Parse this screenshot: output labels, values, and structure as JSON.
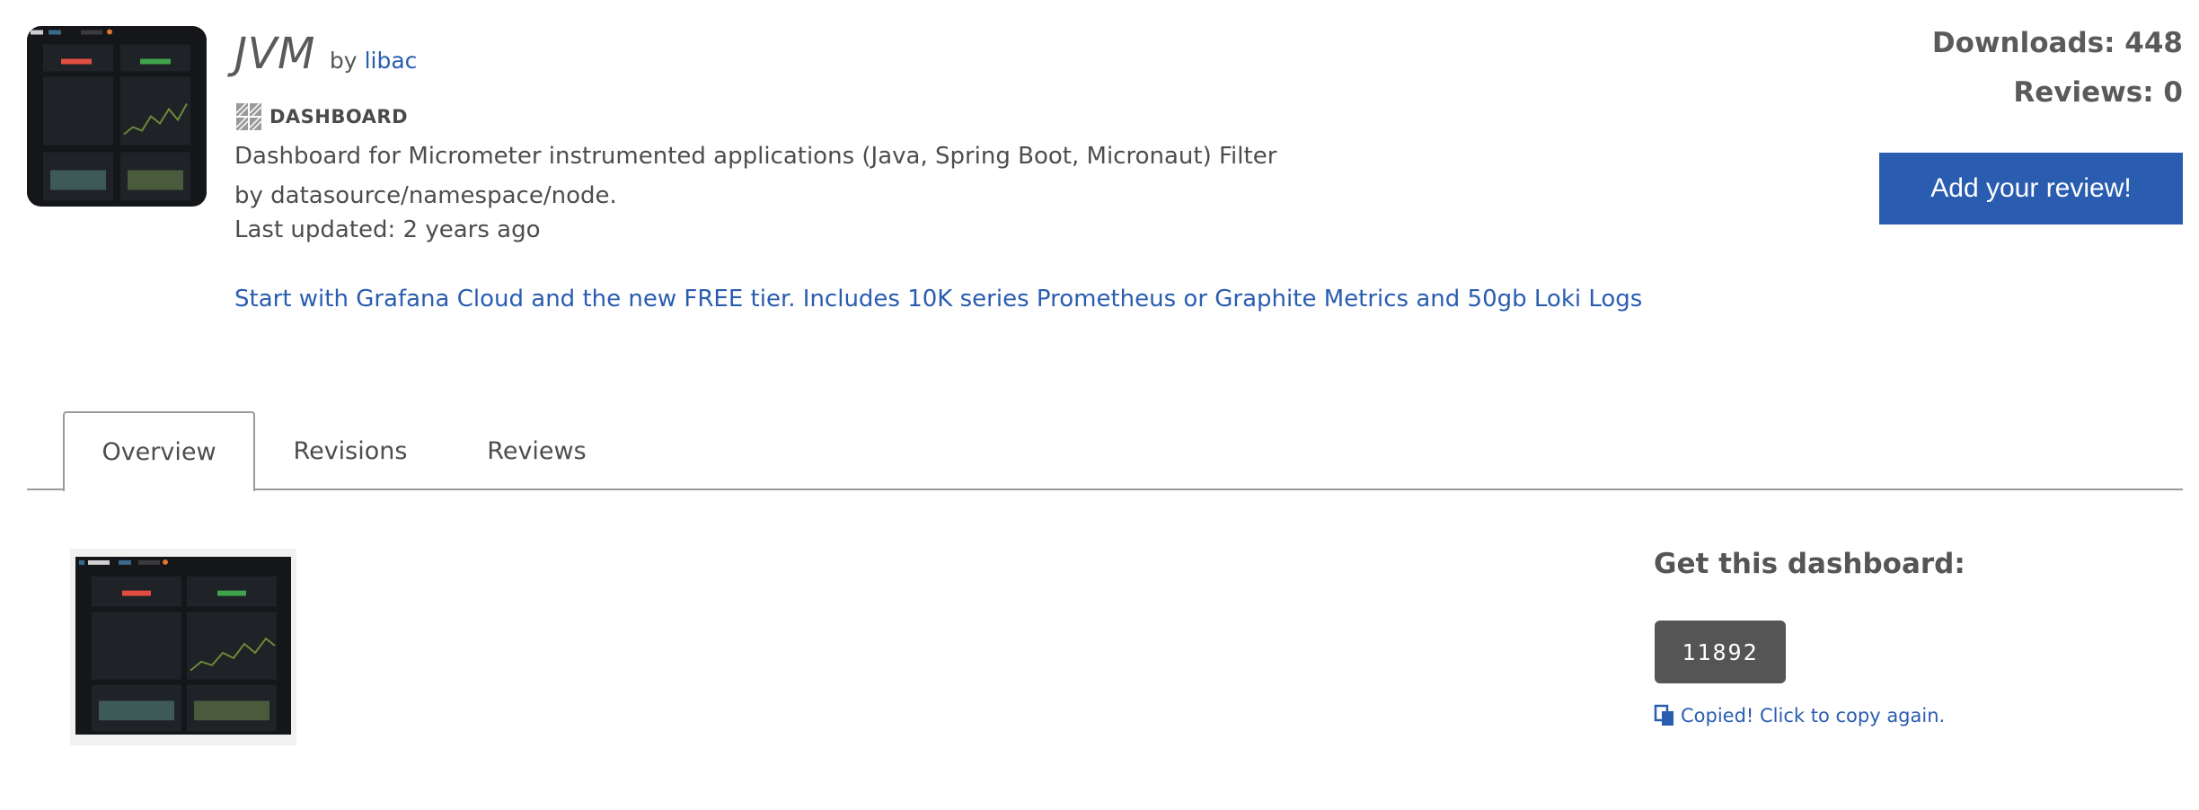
{
  "header": {
    "title": "JVM",
    "by_label": "by",
    "author": "libac",
    "type_label": "DASHBOARD",
    "description": "Dashboard for Micrometer instrumented applications (Java, Spring Boot, Micronaut) Filter by datasource/namespace/node.",
    "last_updated": "Last updated: 2 years ago",
    "promo_link": "Start with Grafana Cloud and the new FREE tier. Includes 10K series Prometheus or Graphite Metrics and 50gb Loki Logs"
  },
  "stats": {
    "downloads": "Downloads: 448",
    "reviews": "Reviews: 0",
    "review_button": "Add your review!"
  },
  "tabs": [
    {
      "label": "Overview",
      "active": true
    },
    {
      "label": "Revisions",
      "active": false
    },
    {
      "label": "Reviews",
      "active": false
    }
  ],
  "get_dashboard": {
    "title": "Get this dashboard:",
    "dashboard_id": "11892",
    "copied_text": "Copied! Click to copy again."
  },
  "colors": {
    "link": "#2a5db0",
    "button": "#2a5db0",
    "id_box": "#555555",
    "thumbnail_bg": "#141619"
  },
  "icons": {
    "type": "dashboard-grid-icon",
    "copy": "clipboard-icon"
  }
}
